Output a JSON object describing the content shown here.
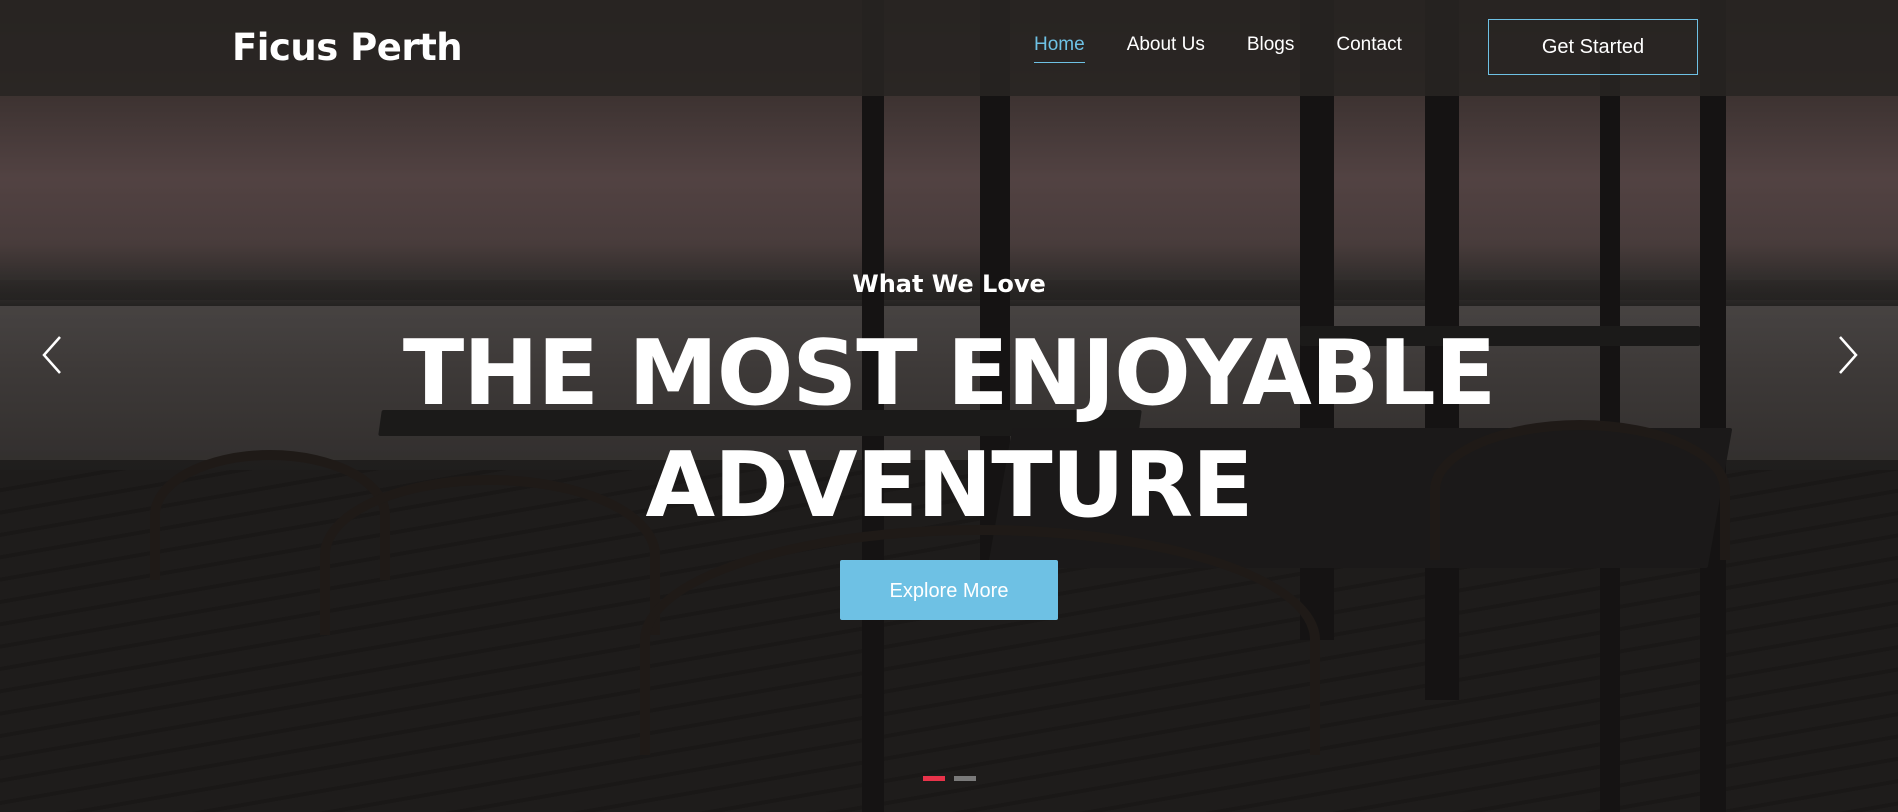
{
  "header": {
    "logo": "Ficus Perth",
    "nav": [
      {
        "label": "Home",
        "active": true
      },
      {
        "label": "About Us",
        "active": false
      },
      {
        "label": "Blogs",
        "active": false
      },
      {
        "label": "Contact",
        "active": false
      }
    ],
    "cta_label": "Get Started"
  },
  "hero": {
    "eyebrow": "What We Love",
    "headline_line1": "THE MOST ENJOYABLE",
    "headline_line2": "ADVENTURE",
    "button_label": "Explore More",
    "prev_icon": "chevron-left-icon",
    "next_icon": "chevron-right-icon",
    "slides_total": 2,
    "active_slide": 1
  },
  "colors": {
    "accent": "#6ec1e4",
    "active_dot": "#e8334a",
    "inactive_dot": "#7a7a7a"
  }
}
